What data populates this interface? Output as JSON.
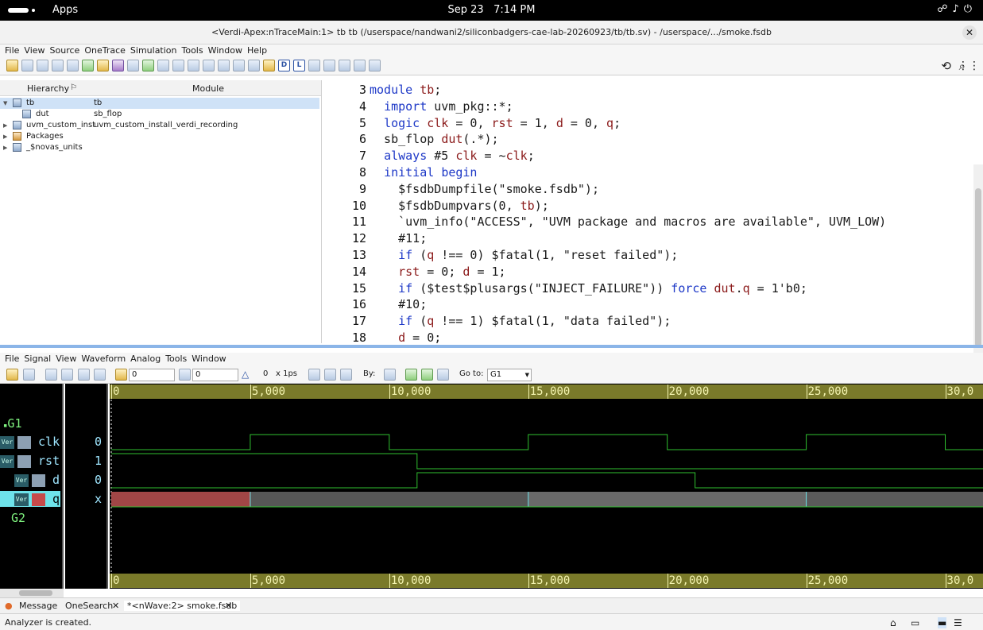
{
  "system": {
    "apps_label": "Apps",
    "date": "Sep 23",
    "time": "7:14 PM"
  },
  "window": {
    "title": "<Verdi-Apex:nTraceMain:1> tb tb (/userspace/nandwani2/siliconbadgers-cae-lab-20260923/tb/tb.sv) - /userspace/.../smoke.fsdb"
  },
  "menu": [
    "File",
    "View",
    "Source",
    "OneTrace",
    "Simulation",
    "Tools",
    "Window",
    "Help"
  ],
  "hierarchy": {
    "col_hierarchy": "Hierarchy",
    "col_module": "Module",
    "rows": [
      {
        "name": "tb",
        "module": "tb"
      },
      {
        "name": "dut",
        "module": "sb_flop"
      },
      {
        "name": "uvm_custom_inst",
        "module": "uvm_custom_install_verdi_recording"
      },
      {
        "name": "Packages",
        "module": ""
      },
      {
        "name": "_$novas_units",
        "module": ""
      }
    ]
  },
  "source": {
    "lines": [
      {
        "no": "3",
        "code": "module tb;"
      },
      {
        "no": "4",
        "code": "  import uvm_pkg::*;"
      },
      {
        "no": "5",
        "code": "  logic clk = 0, rst = 1, d = 0, q;"
      },
      {
        "no": "6",
        "code": "  sb_flop dut(.*);"
      },
      {
        "no": "7",
        "code": "  always #5 clk = ~clk;"
      },
      {
        "no": "8",
        "code": "  initial begin"
      },
      {
        "no": "9",
        "code": "    $fsdbDumpfile(\"smoke.fsdb\");"
      },
      {
        "no": "10",
        "code": "    $fsdbDumpvars(0, tb);"
      },
      {
        "no": "11",
        "code": "    `uvm_info(\"ACCESS\", \"UVM package and macros are available\", UVM_LOW)"
      },
      {
        "no": "12",
        "code": "    #11;"
      },
      {
        "no": "13",
        "code": "    if (q !== 0) $fatal(1, \"reset failed\");"
      },
      {
        "no": "14",
        "code": "    rst = 0; d = 1;"
      },
      {
        "no": "15",
        "code": "    if ($test$plusargs(\"INJECT_FAILURE\")) force dut.q = 1'b0;"
      },
      {
        "no": "16",
        "code": "    #10;"
      },
      {
        "no": "17",
        "code": "    if (q !== 1) $fatal(1, \"data failed\");"
      },
      {
        "no": "18",
        "code": "    d = 0;"
      }
    ]
  },
  "wave_menu": [
    "File",
    "Signal",
    "View",
    "Waveform",
    "Analog",
    "Tools",
    "Window"
  ],
  "wave_toolbar": {
    "cursor_value": "0",
    "marker_value": "0",
    "delta_value": "0",
    "unit": "x 1ps",
    "by_label": "By:",
    "goto_label": "Go to:",
    "goto_value": "G1"
  },
  "signals": {
    "groups": [
      "G1",
      "G2"
    ],
    "items": [
      {
        "name": "clk",
        "value": "0"
      },
      {
        "name": "rst",
        "value": "1"
      },
      {
        "name": "d",
        "value": "0"
      },
      {
        "name": "q",
        "value": "x"
      }
    ],
    "badge": "Ver"
  },
  "timeline": {
    "ticks": [
      "0",
      "5,000",
      "10,000",
      "15,000",
      "20,000",
      "25,000",
      "30,0"
    ],
    "time_end": 31300,
    "clk_edges": [
      5000,
      10000,
      15000,
      20000,
      25000,
      30000
    ],
    "rst_fall": 11000,
    "d_rise": 11000,
    "d_fall": 21000,
    "q_x_until": 5000,
    "q_segments": [
      5000,
      15000,
      25000
    ]
  },
  "tabs": [
    "Message",
    "OneSearch",
    "*<nWave:2> smoke.fsdb"
  ],
  "status": "Analyzer is created."
}
